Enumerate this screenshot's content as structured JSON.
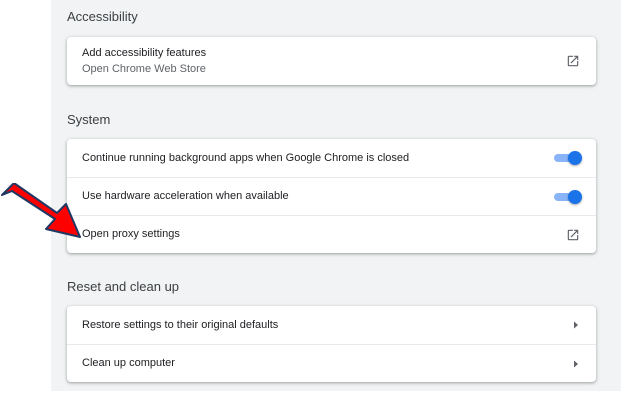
{
  "accessibility": {
    "title": "Accessibility",
    "add_label": "Add accessibility features",
    "add_sublabel": "Open Chrome Web Store",
    "icon": "open-in-new-icon"
  },
  "system": {
    "title": "System",
    "background_apps_label": "Continue running background apps when Google Chrome is closed",
    "background_apps_on": true,
    "hardware_accel_label": "Use hardware acceleration when available",
    "hardware_accel_on": true,
    "proxy_label": "Open proxy settings",
    "icon": "open-in-new-icon"
  },
  "reset": {
    "title": "Reset and clean up",
    "restore_label": "Restore settings to their original defaults",
    "cleanup_label": "Clean up computer",
    "icon": "chevron-right-icon"
  },
  "colors": {
    "accent": "#1a73e8",
    "annotation_arrow": "#ff0000"
  }
}
